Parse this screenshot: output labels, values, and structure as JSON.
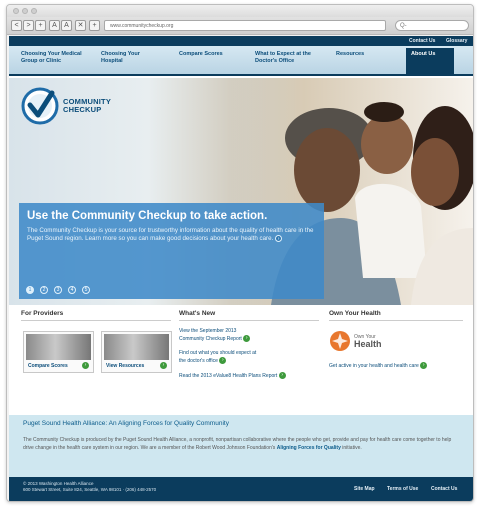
{
  "browser": {
    "url": "www.communitycheckup.org",
    "search_placeholder": "Q-",
    "buttons": [
      "<",
      ">",
      "+",
      "A",
      "A",
      "✕",
      "+"
    ]
  },
  "utility_nav": {
    "contact": "Contact Us",
    "glossary": "Glossary"
  },
  "main_nav": [
    "Choosing Your Medical Group or Clinic",
    "Choosing Your Hospital",
    "Compare Scores",
    "What to Expect at the Doctor's Office",
    "Resources",
    "About Us"
  ],
  "logo": {
    "line1": "COMMUNITY",
    "line2": "CHECKUP"
  },
  "hero": {
    "headline": "Use the Community Checkup to take action.",
    "body": "The Community Checkup is your source for trustworthy information about the quality of health care in the Puget Sound region. Learn more so you can make good decisions about your health care.",
    "dots": [
      "1",
      "2",
      "3",
      "4",
      "5"
    ],
    "active_dot": 0
  },
  "providers": {
    "title": "For Providers",
    "cards": [
      {
        "label": "Compare Scores",
        "button": "›"
      },
      {
        "label": "View Resources",
        "button": "›"
      }
    ]
  },
  "whats_new": {
    "title": "What's New",
    "items": [
      "View the September 2013 Community Checkup Report",
      "Find out what you should expect at the doctor's office",
      "Read the 2013 eValue8 Health Plans Report"
    ]
  },
  "own_health": {
    "title": "Own Your Health",
    "logo_small": "Own Your",
    "logo_big": "Health",
    "link": "Get active in your health and health care"
  },
  "banner": {
    "title": "Puget Sound Health Alliance: An Aligning Forces for Quality Community",
    "body": "The Community Checkup is produced by the Puget Sound Health Alliance, a nonprofit, nonpartisan collaborative where the people who get, provide and pay for health care come together to help drive change in the health care system in our region. We are a member of the Robert Wood Johnson Foundation's ",
    "link": "Aligning Forces for Quality",
    "suffix": " initiative."
  },
  "footer": {
    "copyright": "© 2013 Washington Health Alliance",
    "address": "600 Stewart Street, Suite 824, Seattle, WA 98101 · (206) 448-2570",
    "links": [
      "Site Map",
      "Terms of Use",
      "Contact Us"
    ]
  },
  "colors": {
    "navy": "#0b3c5d",
    "nav_bg": "#cfe3ee",
    "hero_panel": "#3f8ac8",
    "banner_bg": "#cfe7f0",
    "green_button": "#3e9a3c",
    "own_health_orange": "#e8772e"
  }
}
